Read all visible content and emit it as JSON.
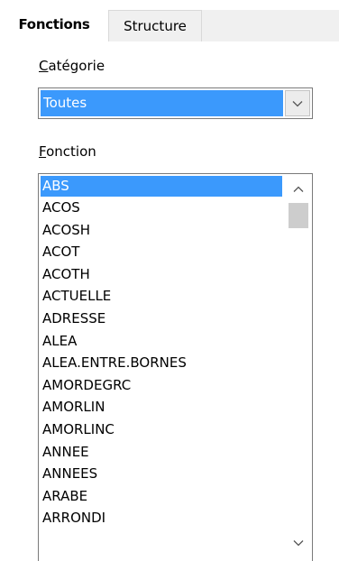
{
  "tabs": [
    {
      "label": "Fonctions",
      "active": true
    },
    {
      "label": "Structure",
      "active": false
    }
  ],
  "category": {
    "label_accel": "C",
    "label_rest": "atégorie",
    "selected": "Toutes"
  },
  "function": {
    "label_accel": "F",
    "label_rest": "onction",
    "items": [
      "ABS",
      "ACOS",
      "ACOSH",
      "ACOT",
      "ACOTH",
      "ACTUELLE",
      "ADRESSE",
      "ALEA",
      "ALEA.ENTRE.BORNES",
      "AMORDEGRC",
      "AMORLIN",
      "AMORLINC",
      "ANNEE",
      "ANNEES",
      "ARABE",
      "ARRONDI"
    ],
    "selected_index": 0
  },
  "colors": {
    "selection": "#3b99fc",
    "tab_inactive": "#f0f0f0",
    "scroll_thumb": "#cdcdcd"
  },
  "icons": {
    "dropdown": "chevron-down-icon",
    "scroll_up": "chevron-up-icon",
    "scroll_down": "chevron-down-icon"
  }
}
